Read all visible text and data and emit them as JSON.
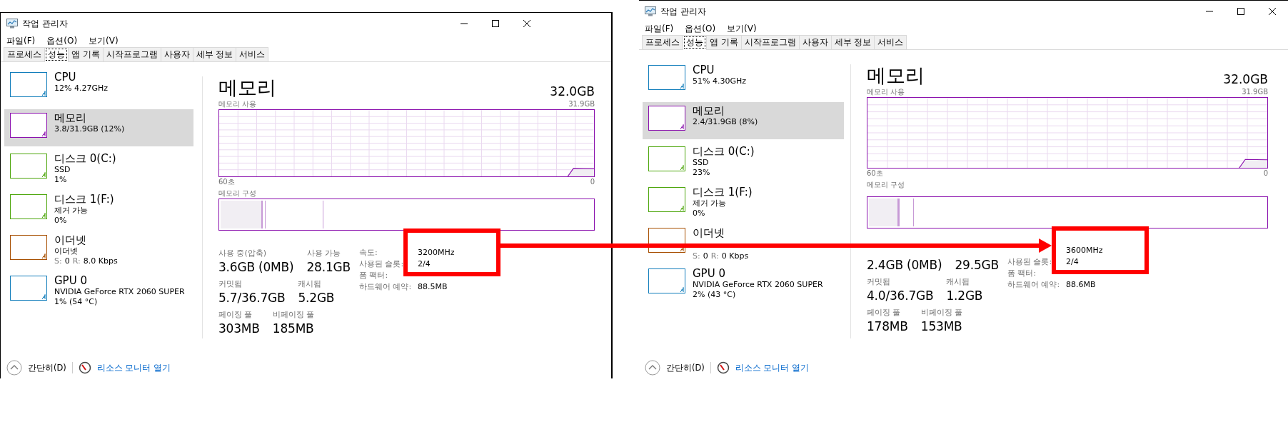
{
  "windows": [
    {
      "title": "작업 관리자",
      "menu": [
        "파일(F)",
        "옵션(O)",
        "보기(V)"
      ],
      "tabs": [
        {
          "label": "프로세스",
          "selected": false
        },
        {
          "label": "성능",
          "selected": true
        },
        {
          "label": "앱 기록",
          "selected": false
        },
        {
          "label": "시작프로그램",
          "selected": false
        },
        {
          "label": "사용자",
          "selected": false
        },
        {
          "label": "세부 정보",
          "selected": false
        },
        {
          "label": "서비스",
          "selected": false
        }
      ],
      "sidebar": {
        "items": [
          {
            "kind": "cpu",
            "title": "CPU",
            "lines": [
              "12% 4.27GHz"
            ],
            "color": "#117dbb",
            "selected": false
          },
          {
            "kind": "memory",
            "title": "메모리",
            "lines": [
              "3.8/31.9GB (12%)"
            ],
            "color": "#8b12ae",
            "selected": true
          },
          {
            "kind": "disk",
            "title": "디스크 0(C:)",
            "lines": [
              "SSD",
              "1%"
            ],
            "color": "#4da60c",
            "selected": false
          },
          {
            "kind": "disk",
            "title": "디스크 1(F:)",
            "lines": [
              "제거 가능",
              "0%"
            ],
            "color": "#4da60c",
            "selected": false
          },
          {
            "kind": "ethernet",
            "title": "이더넷",
            "lines": [
              "이더넷"
            ],
            "traffic": [
              {
                "label": "S:",
                "value": "0"
              },
              {
                "label": "R:",
                "value": "8.0 Kbps"
              }
            ],
            "color": "#a74f01",
            "selected": false
          },
          {
            "kind": "gpu",
            "title": "GPU 0",
            "lines": [
              "NVIDIA GeForce RTX 2060 SUPER",
              "1% (54 °C)"
            ],
            "color": "#117dbb",
            "selected": false
          }
        ]
      },
      "main": {
        "title": "메모리",
        "total": "32.0GB",
        "usage_label": "메모리 사용",
        "usage_max": "31.9GB",
        "axis_start": "60초",
        "axis_end": "0",
        "composition_label": "메모리 구성",
        "composition": [
          {
            "kind": "in_use",
            "level": 0.114
          },
          {
            "kind": "modified",
            "level": 0.007
          },
          {
            "kind": "standby",
            "level": 0.156
          }
        ],
        "stats": [
          {
            "label": "사용 중(압축)",
            "value": "3.6GB (0MB)"
          },
          {
            "label": "사용 가능",
            "value": "28.1GB"
          },
          {
            "label": "커밋됨",
            "value": "5.7/36.7GB"
          },
          {
            "label": "캐시됨",
            "value": "5.2GB"
          },
          {
            "label": "페이징 풀",
            "value": "303MB"
          },
          {
            "label": "비페이징 풀",
            "value": "185MB"
          }
        ],
        "details": [
          {
            "label": "속도:",
            "value": "3200MHz"
          },
          {
            "label": "사용된 슬롯:",
            "value": "2/4"
          },
          {
            "label": "폼 팩터:"
          },
          {
            "label": "하드웨어 예약:",
            "value": "88.5MB"
          }
        ],
        "highlight_box": true
      },
      "footer": {
        "collapse": "간단히(D)",
        "link": "리소스 모니터 열기"
      }
    },
    {
      "title": "작업 관리자",
      "menu": [
        "파일(F)",
        "옵션(O)",
        "보기(V)"
      ],
      "tabs": [
        {
          "label": "프로세스",
          "selected": false
        },
        {
          "label": "성능",
          "selected": true
        },
        {
          "label": "앱 기록",
          "selected": false
        },
        {
          "label": "시작프로그램",
          "selected": false
        },
        {
          "label": "사용자",
          "selected": false
        },
        {
          "label": "세부 정보",
          "selected": false
        },
        {
          "label": "서비스",
          "selected": false
        }
      ],
      "sidebar": {
        "items": [
          {
            "kind": "cpu",
            "title": "CPU",
            "lines": [
              "51% 4.30GHz"
            ],
            "color": "#117dbb",
            "selected": false
          },
          {
            "kind": "memory",
            "title": "메모리",
            "lines": [
              "2.4/31.9GB (8%)"
            ],
            "color": "#8b12ae",
            "selected": true
          },
          {
            "kind": "disk",
            "title": "디스크 0(C:)",
            "lines": [
              "SSD",
              "23%"
            ],
            "color": "#4da60c",
            "selected": false
          },
          {
            "kind": "disk",
            "title": "디스크 1(F:)",
            "lines": [
              "제거 가능",
              "0%"
            ],
            "color": "#4da60c",
            "selected": false
          },
          {
            "kind": "ethernet",
            "title": "이더넷",
            "traffic": [
              {
                "label": "S:",
                "value": "0"
              },
              {
                "label": "R:",
                "value": "0 Kbps"
              }
            ],
            "color": "#a74f01",
            "selected": false
          },
          {
            "kind": "gpu",
            "title": "GPU 0",
            "lines": [
              "NVIDIA GeForce RTX 2060 SUPER",
              "2% (43 °C)"
            ],
            "color": "#117dbb",
            "selected": false
          }
        ]
      },
      "main": {
        "title": "메모리",
        "total": "32.0GB",
        "usage_label": "메모리 사용",
        "usage_max": "31.9GB",
        "axis_start": "60초",
        "axis_end": "0",
        "composition_label": "메모리 구성",
        "composition": [
          {
            "kind": "in_use",
            "level": 0.076
          },
          {
            "kind": "modified",
            "level": 0.002
          },
          {
            "kind": "standby",
            "level": 0.036
          }
        ],
        "stats": [
          {
            "value": "2.4GB (0MB)"
          },
          {
            "value": "29.5GB"
          },
          {
            "label": "커밋됨",
            "value": "4.0/36.7GB"
          },
          {
            "label": "캐시됨",
            "value": "1.2GB"
          },
          {
            "label": "페이징 풀",
            "value": "178MB"
          },
          {
            "label": "비페이징 풀",
            "value": "153MB"
          }
        ],
        "details": [
          {
            "value": "3600MHz"
          },
          {
            "label": "사용된 슬롯:",
            "value": "2/4"
          },
          {
            "label": "폼 팩터:"
          },
          {
            "label": "하드웨어 예약:",
            "value": "88.6MB"
          }
        ],
        "highlight_box": true
      },
      "footer": {
        "collapse": "간단히(D)",
        "link": "리소스 모니터 열기"
      }
    }
  ]
}
